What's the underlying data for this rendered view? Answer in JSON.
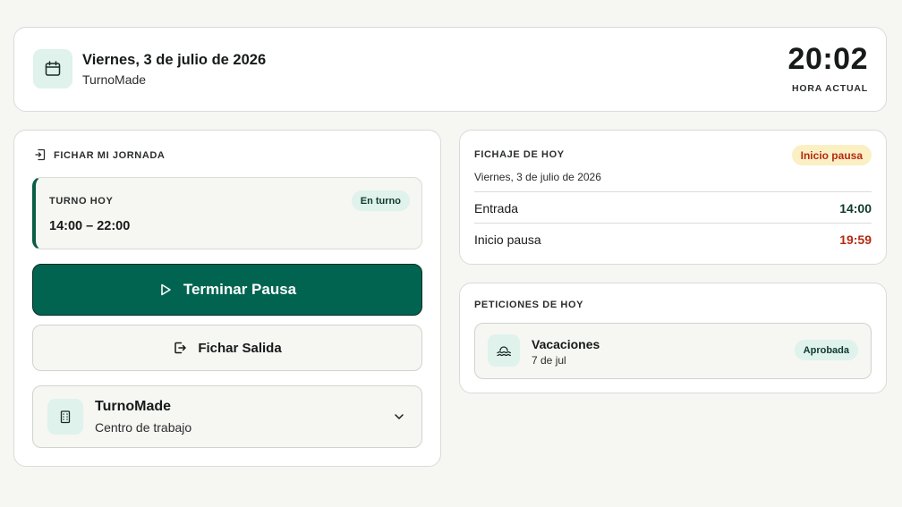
{
  "header": {
    "date": "Viernes, 3 de julio de 2026",
    "app_name": "TurnoMade",
    "clock": "20:02",
    "clock_label": "HORA ACTUAL"
  },
  "clock_in": {
    "title": "FICHAR MI JORNADA",
    "shift": {
      "label": "TURNO HOY",
      "time": "14:00 – 22:00",
      "status": "En turno"
    },
    "primary_button": "Terminar Pausa",
    "secondary_button": "Fichar Salida",
    "workplace": {
      "name": "TurnoMade",
      "subtitle": "Centro de trabajo"
    }
  },
  "today": {
    "title": "FICHAJE DE HOY",
    "status": "Inicio pausa",
    "date": "Viernes, 3 de julio de 2026",
    "rows": [
      {
        "label": "Entrada",
        "value": "14:00"
      },
      {
        "label": "Inicio pausa",
        "value": "19:59"
      }
    ]
  },
  "requests": {
    "title": "PETICIONES DE HOY",
    "items": [
      {
        "name": "Vacaciones",
        "date": "7 de jul",
        "status": "Aprobada"
      }
    ]
  },
  "colors": {
    "accent": "#006450",
    "accent_light": "#dff2ec",
    "warning_bg": "#fbefc4",
    "alert_text": "#b52a12"
  },
  "icons": {
    "header": "calendar-icon",
    "clock_in_title": "clock-in-icon",
    "primary_button": "play-icon",
    "secondary_button": "exit-icon",
    "workplace": "building-icon",
    "workplace_toggle": "chevron-down-icon",
    "request": "beach-icon"
  }
}
